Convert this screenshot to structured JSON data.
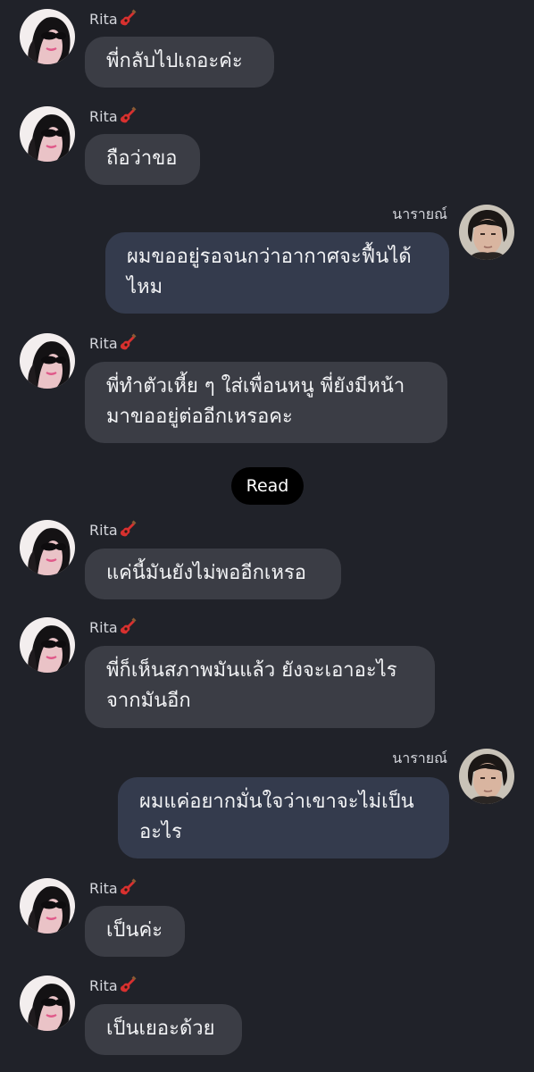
{
  "conversation": {
    "contact_name": "Rita",
    "contact_name_emoji_icon": "guitar-icon",
    "self_name": "นารายณ์",
    "read_label": "Read",
    "messages": [
      {
        "sender": "Rita",
        "text": "พี่กลับไปเถอะค่ะ"
      },
      {
        "sender": "Rita",
        "text": "ถือว่าขอ"
      },
      {
        "sender": "นารายณ์",
        "text": "ผมขออยู่รอจนกว่าอากาศจะฟื้นได้\nไหม"
      },
      {
        "sender": "Rita",
        "text": "พี่ทำตัวเหี้ย ๆ ใส่เพื่อนหนู พี่ยังมีหน้า\nมาขออยู่ต่ออีกเหรอคะ"
      },
      {
        "sender": "Rita",
        "text": "แค่นี้มันยังไม่พออีกเหรอ"
      },
      {
        "sender": "Rita",
        "text": "พี่ก็เห็นสภาพมันแล้ว ยังจะเอาอะไร\nจากมันอีก"
      },
      {
        "sender": "นารายณ์",
        "text": "ผมแค่อยากมั่นใจว่าเขาจะไม่เป็น\nอะไร"
      },
      {
        "sender": "Rita",
        "text": "เป็นค่ะ"
      },
      {
        "sender": "Rita",
        "text": "เป็นเยอะด้วย"
      }
    ]
  },
  "colors": {
    "background": "#202229",
    "incoming_bubble": "#3b3d45",
    "outgoing_bubble": "#343b4d",
    "text": "#f2f3f5",
    "name_text": "#d4d6dc",
    "read_pill": "#000000"
  }
}
